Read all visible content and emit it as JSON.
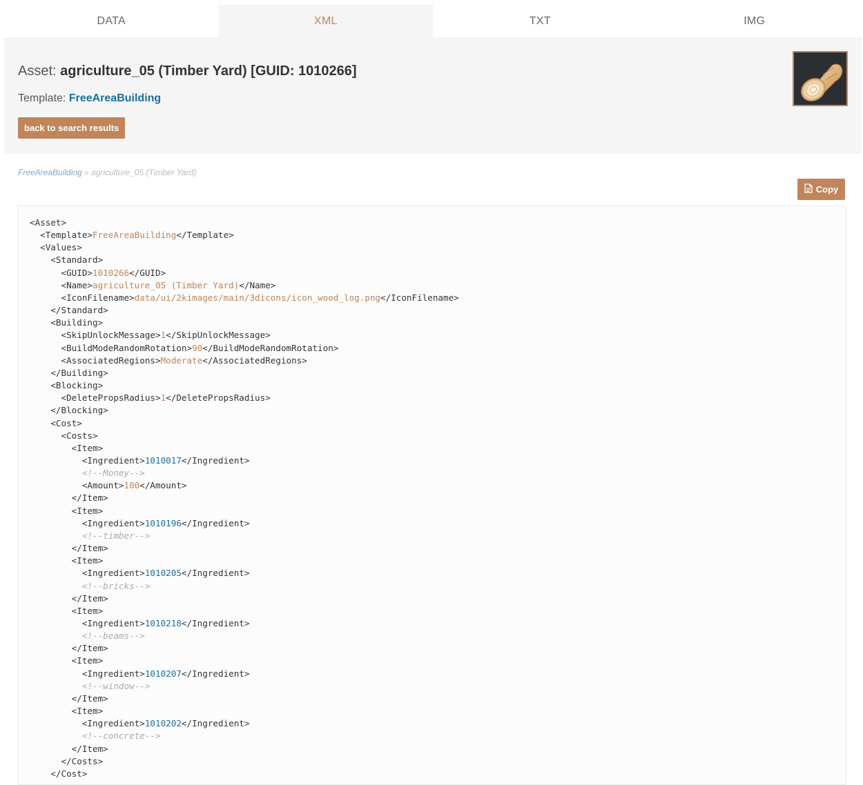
{
  "tabs": [
    {
      "label": "DATA",
      "active": false
    },
    {
      "label": "XML",
      "active": true
    },
    {
      "label": "TXT",
      "active": false
    },
    {
      "label": "IMG",
      "active": false
    }
  ],
  "header": {
    "asset_label": "Asset:",
    "asset_value": "agriculture_05 (Timber Yard) [GUID: 1010266]",
    "template_label": "Template:",
    "template_value": "FreeAreaBuilding",
    "back_button": "back to search results",
    "icon": "wood-log-icon"
  },
  "breadcrumb": {
    "link": "FreeAreaBuilding",
    "separator": "»",
    "current": "agriculture_05 (Timber Yard)"
  },
  "copy_button": "Copy",
  "colors": {
    "accent": "#c0855a",
    "link": "#1a6fa0",
    "header_bg": "#f5f5f5",
    "comment": "#aaaaaa"
  },
  "xml_lines": [
    {
      "indent": 0,
      "parts": [
        [
          "t",
          "<Asset>"
        ]
      ]
    },
    {
      "indent": 1,
      "parts": [
        [
          "t",
          "<Template>"
        ],
        [
          "v",
          "FreeAreaBuilding"
        ],
        [
          "t",
          "</Template>"
        ]
      ]
    },
    {
      "indent": 1,
      "parts": [
        [
          "t",
          "<Values>"
        ]
      ]
    },
    {
      "indent": 2,
      "parts": [
        [
          "t",
          "<Standard>"
        ]
      ]
    },
    {
      "indent": 3,
      "parts": [
        [
          "t",
          "<GUID>"
        ],
        [
          "v",
          "1010266"
        ],
        [
          "t",
          "</GUID>"
        ]
      ]
    },
    {
      "indent": 3,
      "parts": [
        [
          "t",
          "<Name>"
        ],
        [
          "v",
          "agriculture_05 (Timber Yard)"
        ],
        [
          "t",
          "</Name>"
        ]
      ]
    },
    {
      "indent": 3,
      "parts": [
        [
          "t",
          "<IconFilename>"
        ],
        [
          "v",
          "data/ui/2kimages/main/3dicons/icon_wood_log.png"
        ],
        [
          "t",
          "</IconFilename>"
        ]
      ]
    },
    {
      "indent": 2,
      "parts": [
        [
          "t",
          "</Standard>"
        ]
      ]
    },
    {
      "indent": 2,
      "parts": [
        [
          "t",
          "<Building>"
        ]
      ]
    },
    {
      "indent": 3,
      "parts": [
        [
          "t",
          "<SkipUnlockMessage>"
        ],
        [
          "v",
          "1"
        ],
        [
          "t",
          "</SkipUnlockMessage>"
        ]
      ]
    },
    {
      "indent": 3,
      "parts": [
        [
          "t",
          "<BuildModeRandomRotation>"
        ],
        [
          "v",
          "90"
        ],
        [
          "t",
          "</BuildModeRandomRotation>"
        ]
      ]
    },
    {
      "indent": 3,
      "parts": [
        [
          "t",
          "<AssociatedRegions>"
        ],
        [
          "v",
          "Moderate"
        ],
        [
          "t",
          "</AssociatedRegions>"
        ]
      ]
    },
    {
      "indent": 2,
      "parts": [
        [
          "t",
          "</Building>"
        ]
      ]
    },
    {
      "indent": 2,
      "parts": [
        [
          "t",
          "<Blocking>"
        ]
      ]
    },
    {
      "indent": 3,
      "parts": [
        [
          "t",
          "<DeletePropsRadius>"
        ],
        [
          "v",
          "1"
        ],
        [
          "t",
          "</DeletePropsRadius>"
        ]
      ]
    },
    {
      "indent": 2,
      "parts": [
        [
          "t",
          "</Blocking>"
        ]
      ]
    },
    {
      "indent": 2,
      "parts": [
        [
          "t",
          "<Cost>"
        ]
      ]
    },
    {
      "indent": 3,
      "parts": [
        [
          "t",
          "<Costs>"
        ]
      ]
    },
    {
      "indent": 4,
      "parts": [
        [
          "t",
          "<Item>"
        ]
      ]
    },
    {
      "indent": 5,
      "parts": [
        [
          "t",
          "<Ingredient>"
        ],
        [
          "n",
          "1010017"
        ],
        [
          "t",
          "</Ingredient>"
        ]
      ]
    },
    {
      "indent": 5,
      "parts": [
        [
          "c",
          "<!--Money-->"
        ]
      ]
    },
    {
      "indent": 5,
      "parts": [
        [
          "t",
          "<Amount>"
        ],
        [
          "v",
          "100"
        ],
        [
          "t",
          "</Amount>"
        ]
      ]
    },
    {
      "indent": 4,
      "parts": [
        [
          "t",
          "</Item>"
        ]
      ]
    },
    {
      "indent": 4,
      "parts": [
        [
          "t",
          "<Item>"
        ]
      ]
    },
    {
      "indent": 5,
      "parts": [
        [
          "t",
          "<Ingredient>"
        ],
        [
          "n",
          "1010196"
        ],
        [
          "t",
          "</Ingredient>"
        ]
      ]
    },
    {
      "indent": 5,
      "parts": [
        [
          "c",
          "<!--timber-->"
        ]
      ]
    },
    {
      "indent": 4,
      "parts": [
        [
          "t",
          "</Item>"
        ]
      ]
    },
    {
      "indent": 4,
      "parts": [
        [
          "t",
          "<Item>"
        ]
      ]
    },
    {
      "indent": 5,
      "parts": [
        [
          "t",
          "<Ingredient>"
        ],
        [
          "n",
          "1010205"
        ],
        [
          "t",
          "</Ingredient>"
        ]
      ]
    },
    {
      "indent": 5,
      "parts": [
        [
          "c",
          "<!--bricks-->"
        ]
      ]
    },
    {
      "indent": 4,
      "parts": [
        [
          "t",
          "</Item>"
        ]
      ]
    },
    {
      "indent": 4,
      "parts": [
        [
          "t",
          "<Item>"
        ]
      ]
    },
    {
      "indent": 5,
      "parts": [
        [
          "t",
          "<Ingredient>"
        ],
        [
          "n",
          "1010218"
        ],
        [
          "t",
          "</Ingredient>"
        ]
      ]
    },
    {
      "indent": 5,
      "parts": [
        [
          "c",
          "<!--beams-->"
        ]
      ]
    },
    {
      "indent": 4,
      "parts": [
        [
          "t",
          "</Item>"
        ]
      ]
    },
    {
      "indent": 4,
      "parts": [
        [
          "t",
          "<Item>"
        ]
      ]
    },
    {
      "indent": 5,
      "parts": [
        [
          "t",
          "<Ingredient>"
        ],
        [
          "n",
          "1010207"
        ],
        [
          "t",
          "</Ingredient>"
        ]
      ]
    },
    {
      "indent": 5,
      "parts": [
        [
          "c",
          "<!--window-->"
        ]
      ]
    },
    {
      "indent": 4,
      "parts": [
        [
          "t",
          "</Item>"
        ]
      ]
    },
    {
      "indent": 4,
      "parts": [
        [
          "t",
          "<Item>"
        ]
      ]
    },
    {
      "indent": 5,
      "parts": [
        [
          "t",
          "<Ingredient>"
        ],
        [
          "n",
          "1010202"
        ],
        [
          "t",
          "</Ingredient>"
        ]
      ]
    },
    {
      "indent": 5,
      "parts": [
        [
          "c",
          "<!--concrete-->"
        ]
      ]
    },
    {
      "indent": 4,
      "parts": [
        [
          "t",
          "</Item>"
        ]
      ]
    },
    {
      "indent": 3,
      "parts": [
        [
          "t",
          "</Costs>"
        ]
      ]
    },
    {
      "indent": 2,
      "parts": [
        [
          "t",
          "</Cost>"
        ]
      ]
    }
  ]
}
